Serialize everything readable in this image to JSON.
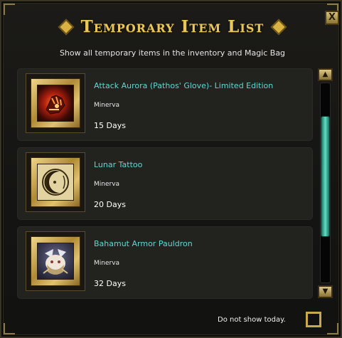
{
  "window": {
    "title": "Temporary Item List",
    "close_label": "X",
    "subtitle": "Show all temporary items in the inventory and Magic Bag"
  },
  "items": [
    {
      "name": "Attack Aurora (Pathos' Glove)- Limited Edition",
      "owner": "Minerva",
      "duration": "15 Days",
      "icon": "gauntlet-icon"
    },
    {
      "name": "Lunar Tattoo",
      "owner": "Minerva",
      "duration": "20 Days",
      "icon": "moon-tattoo-icon"
    },
    {
      "name": "Bahamut Armor Pauldron",
      "owner": "Minerva",
      "duration": "32 Days",
      "icon": "pauldron-icon"
    }
  ],
  "scrollbar": {
    "up_symbol": "▲",
    "down_symbol": "▼",
    "position_fraction": 0.42
  },
  "footer": {
    "checkbox_label": "Do not show today.",
    "checked": false
  },
  "colors": {
    "title_gold": "#e8c65a",
    "item_name_teal": "#62d6d0",
    "scroll_thumb_teal": "#5de0c4"
  }
}
